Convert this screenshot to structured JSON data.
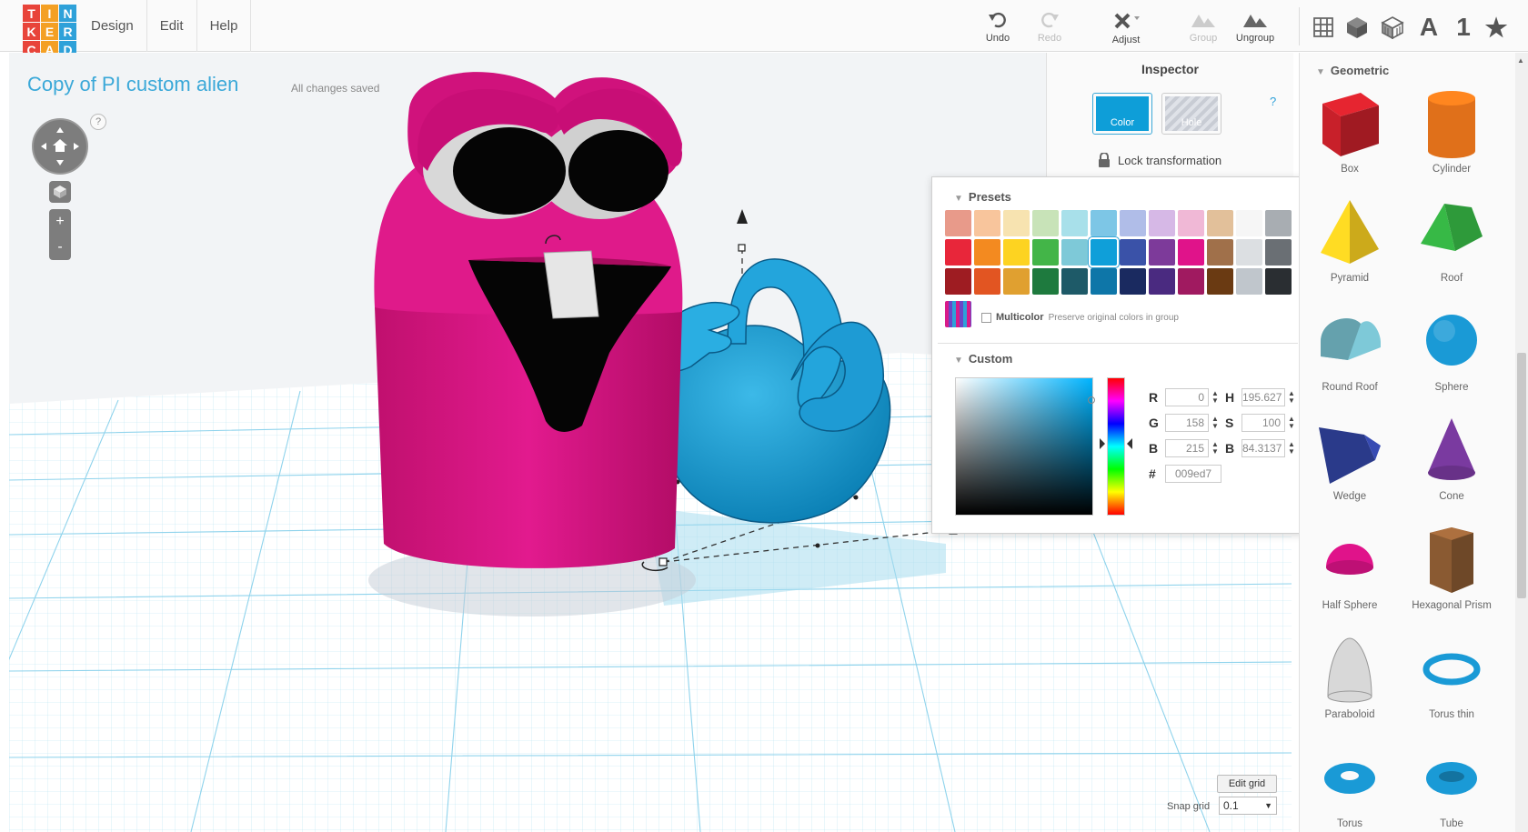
{
  "logo": {
    "letters": [
      "T",
      "I",
      "N",
      "K",
      "E",
      "R",
      "C",
      "A",
      "D"
    ],
    "colors": [
      "#e8443a",
      "#f4a024",
      "#2ea1d9",
      "#e8443a",
      "#f4a024",
      "#2ea1d9",
      "#e8443a",
      "#f4a024",
      "#2ea1d9"
    ]
  },
  "menu": [
    {
      "label": "Design"
    },
    {
      "label": "Edit"
    },
    {
      "label": "Help"
    }
  ],
  "toolbar": {
    "undo": "Undo",
    "redo": "Redo",
    "adjust": "Adjust",
    "group": "Group",
    "ungroup": "Ungroup"
  },
  "views": {
    "text_icon": "A",
    "number_icon": "1",
    "star_icon": "★"
  },
  "document": {
    "title": "Copy of PI custom alien",
    "save_status": "All changes saved"
  },
  "nav": {
    "help": "?",
    "zoom_in": "+",
    "zoom_out": "-"
  },
  "inspector": {
    "title": "Inspector",
    "help": "?",
    "color_label": "Color",
    "hole_label": "Hole",
    "lock_label": "Lock transformation"
  },
  "color_popup": {
    "presets_label": "Presets",
    "presets": [
      "#e89a8a",
      "#f8c59c",
      "#f7e3b0",
      "#c8e3b8",
      "#a8e0ea",
      "#7dc6e6",
      "#b0bde8",
      "#d6b8e6",
      "#f0b8d6",
      "#e2c09a",
      "#f6f6f6",
      "#a8adb2",
      "#e8263a",
      "#f38a20",
      "#fdd321",
      "#43b548",
      "#7ec9d8",
      "#0f9fd9",
      "#3a52a8",
      "#7d3a9a",
      "#e0138a",
      "#a0704a",
      "#dcdfe2",
      "#6a6f74",
      "#9e1c22",
      "#e25522",
      "#e0a030",
      "#1e7a3e",
      "#1e5a68",
      "#0e76a8",
      "#1a2a60",
      "#4a2a80",
      "#a01a60",
      "#6a3a12",
      "#c0c6cc",
      "#2a2e32"
    ],
    "selected_preset": 17,
    "multicolor_label": "Multicolor",
    "multicolor_desc": "Preserve original colors in group",
    "custom_label": "Custom",
    "fields": {
      "r": "0",
      "g": "158",
      "b": "215",
      "h": "195.627",
      "s": "100",
      "bv": "84.3137",
      "hex": "009ed7"
    },
    "labels": {
      "r": "R",
      "g": "G",
      "b": "B",
      "h": "H",
      "s": "S",
      "bv": "B",
      "hex": "#"
    }
  },
  "grid_controls": {
    "edit_grid": "Edit grid",
    "snap_label": "Snap grid",
    "snap_value": "0.1"
  },
  "shapes_panel": {
    "category": "Geometric",
    "shapes": [
      {
        "label": "Box",
        "icon": "box-icon",
        "color": "#c8202a"
      },
      {
        "label": "Cylinder",
        "icon": "cylinder-icon",
        "color": "#e0701a"
      },
      {
        "label": "Pyramid",
        "icon": "pyramid-icon",
        "color": "#f0c820"
      },
      {
        "label": "Roof",
        "icon": "roof-icon",
        "color": "#2e9a3a"
      },
      {
        "label": "Round Roof",
        "icon": "round-roof-icon",
        "color": "#7ec9d8"
      },
      {
        "label": "Sphere",
        "icon": "sphere-icon",
        "color": "#1a9ad6"
      },
      {
        "label": "Wedge",
        "icon": "wedge-icon",
        "color": "#2a3a8a"
      },
      {
        "label": "Cone",
        "icon": "cone-icon",
        "color": "#7a3aa0"
      },
      {
        "label": "Half Sphere",
        "icon": "half-sphere-icon",
        "color": "#e0138a"
      },
      {
        "label": "Hexagonal Prism",
        "icon": "hexagonal-prism-icon",
        "color": "#8a5a32"
      },
      {
        "label": "Paraboloid",
        "icon": "paraboloid-icon",
        "color": "#d8d8d8"
      },
      {
        "label": "Torus thin",
        "icon": "torus-thin-icon",
        "color": "#1a9ad6"
      },
      {
        "label": "Torus",
        "icon": "torus-icon",
        "color": "#1a9ad6"
      },
      {
        "label": "Tube",
        "icon": "tube-icon",
        "color": "#1a9ad6"
      }
    ]
  }
}
